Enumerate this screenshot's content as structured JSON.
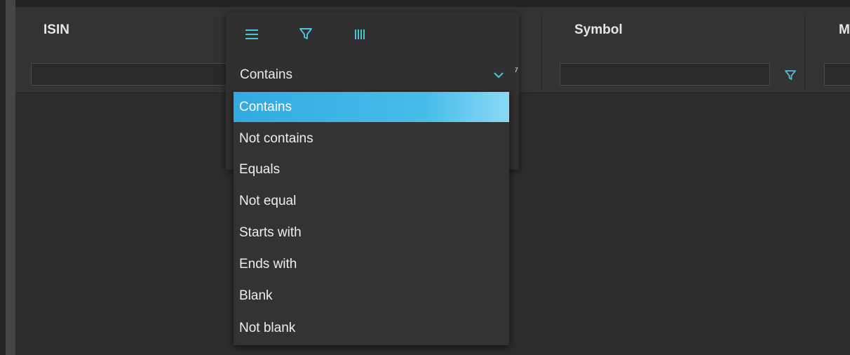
{
  "colors": {
    "accent": "#4cc3d9",
    "selected": "#3ab0e6",
    "background": "#2d2d2d",
    "header": "#333333"
  },
  "columns": [
    {
      "title": "ISIN"
    },
    {
      "title": "Symbol"
    },
    {
      "title": "M"
    }
  ],
  "menu": {
    "tabs": [
      {
        "name": "general",
        "icon": "menu-icon"
      },
      {
        "name": "filter",
        "icon": "filter-icon"
      },
      {
        "name": "columns",
        "icon": "columns-icon"
      }
    ],
    "condition": {
      "selected": "Contains",
      "options": [
        "Contains",
        "Not contains",
        "Equals",
        "Not equal",
        "Starts with",
        "Ends with",
        "Blank",
        "Not blank"
      ],
      "selected_index": 0
    }
  }
}
